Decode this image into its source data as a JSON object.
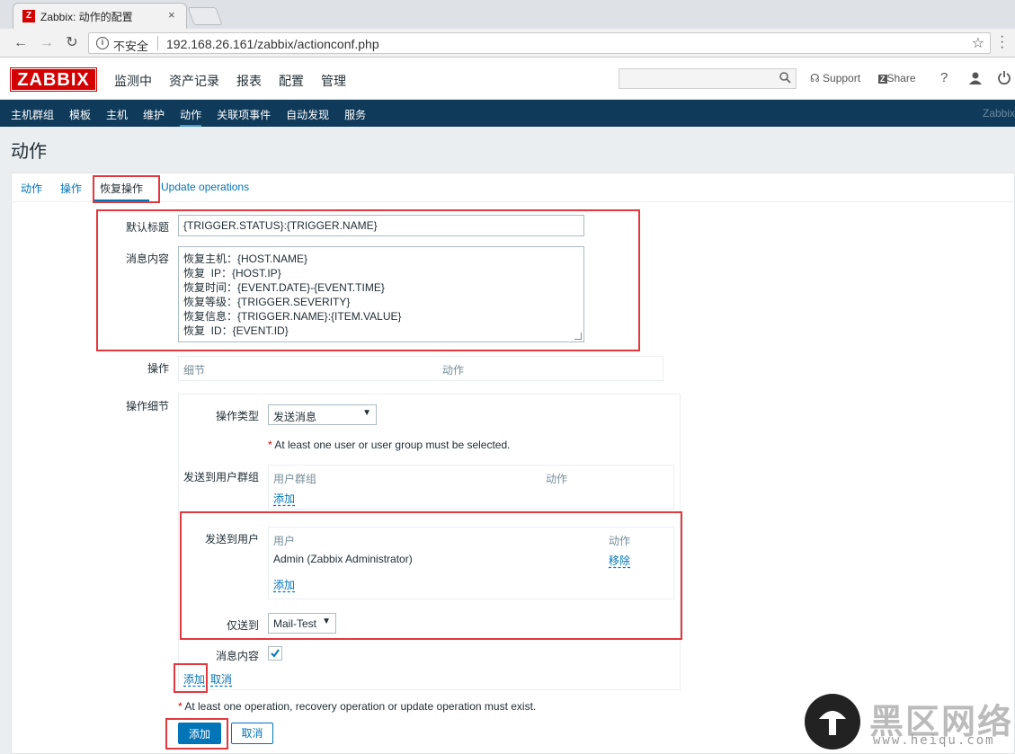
{
  "browser": {
    "tab_title": "Zabbix: 动作的配置",
    "tab_favicon": "Z",
    "tab_close": "×",
    "insecure_label": "不安全",
    "url": "192.168.26.161/zabbix/actionconf.php"
  },
  "header": {
    "logo": "ZABBIX",
    "menu": [
      "监测中",
      "资产记录",
      "报表",
      "配置",
      "管理"
    ],
    "support": "Support",
    "share": "Share",
    "help": "?"
  },
  "subnav": {
    "items": [
      "主机群组",
      "模板",
      "主机",
      "维护",
      "动作",
      "关联项事件",
      "自动发现",
      "服务"
    ],
    "active_index": 4,
    "right_text": "Zabbix"
  },
  "page": {
    "title": "动作"
  },
  "tabs": [
    "动作",
    "操作",
    "恢复操作",
    "Update operations"
  ],
  "form": {
    "default_subject_label": "默认标题",
    "default_subject_value": "{TRIGGER.STATUS}:{TRIGGER.NAME}",
    "message_label": "消息内容",
    "message_value": "恢复主机：{HOST.NAME}\n恢复  IP：{HOST.IP}\n恢复时间：{EVENT.DATE}-{EVENT.TIME}\n恢复等级：{TRIGGER.SEVERITY}\n恢复信息：{TRIGGER.NAME}:{ITEM.VALUE}\n恢复  ID：{EVENT.ID}",
    "operations_label": "操作",
    "operations_col_details": "细节",
    "operations_col_action": "动作",
    "op_details_label": "操作细节",
    "op_type_label": "操作类型",
    "op_type_value": "发送消息",
    "user_required_note": "At least one user or user group must be selected.",
    "send_to_groups_label": "发送到用户群组",
    "groups_col_group": "用户群组",
    "groups_col_action": "动作",
    "groups_add": "添加",
    "send_to_users_label": "发送到用户",
    "users_col_user": "用户",
    "users_col_action": "动作",
    "users": [
      {
        "name": "Admin (Zabbix Administrator)",
        "action": "移除"
      }
    ],
    "users_add": "添加",
    "only_send_to_label": "仅送到",
    "only_send_to_value": "Mail-Test",
    "message_checkbox_label": "消息内容",
    "message_checkbox_checked": true,
    "op_add": "添加",
    "op_cancel": "取消",
    "operation_required_note": "At least one operation, recovery operation or update operation must exist.",
    "add_button": "添加",
    "cancel_button": "取消"
  },
  "watermark": {
    "title": "黑区网络",
    "url": "www.heiqu.com"
  },
  "colors": {
    "brand_red": "#d40000",
    "nav_blue": "#0f3a5a",
    "link_blue": "#0275b8",
    "annotation_red": "#e0393e"
  }
}
